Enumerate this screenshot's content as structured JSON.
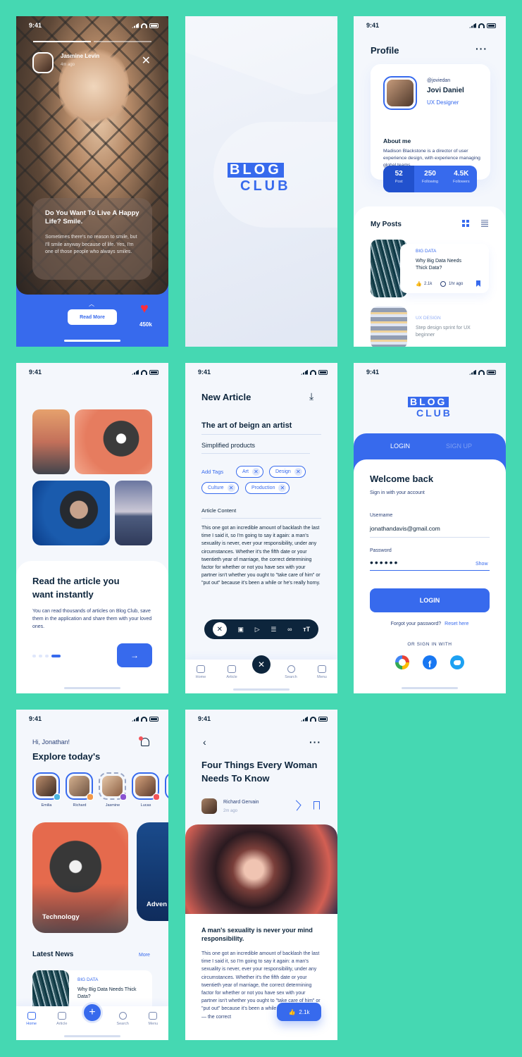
{
  "status_time": "9:41",
  "story": {
    "author": "Jasmine Levin",
    "time_ago": "4m ago",
    "title": "Do You Want To Live A Happy Life? Smile.",
    "body": "Sometimes there's no reason to smile, but I'll smile anyway because of life. Yes, I'm one of those people who always smiles.",
    "read_more": "Read More",
    "likes": "450k"
  },
  "splash": {
    "logo_line1": "BLOG",
    "logo_line2": "CLUB"
  },
  "profile": {
    "title": "Profile",
    "handle": "@joviedan",
    "name": "Jovi Daniel",
    "role": "UX Designer",
    "about_label": "About me",
    "about": "Madison Blackstone is a director of user experience design, with experience managing global teams.",
    "stats": [
      {
        "value": "52",
        "label": "Post"
      },
      {
        "value": "250",
        "label": "Following"
      },
      {
        "value": "4.5K",
        "label": "Followers"
      }
    ],
    "my_posts": "My Posts",
    "posts": [
      {
        "tag": "BIG DATA",
        "title": "Why Big Data Needs Thick Data?",
        "likes": "2.1k",
        "time": "1hr ago"
      },
      {
        "tag": "UX DESIGN",
        "title": "Step design sprint for UX beginner"
      }
    ]
  },
  "onboarding": {
    "title": "Read the article you want instantly",
    "body": "You can read thousands of articles on Blog Club, save them in the application and share them with your loved ones.",
    "next_icon": "arrow-right-icon"
  },
  "new_article": {
    "title": "New Article",
    "article_title": "The art of beign an artist",
    "subtitle": "Simplified products",
    "add_tags": "Add Tags",
    "tags": [
      "Art",
      "Design",
      "Culture",
      "Production"
    ],
    "content_label": "Article Content",
    "content": "This one got an incredible amount of backlash the last time I said it, so I'm going to say it again: a man's sexuality is never, ever your responsibility, under any circumstances. Whether it's the fifth date or your twentieth year of marriage, the correct determining factor for whether or not you have sex with your partner isn't whether you ought to \"take care of him\" or \"put out\" because it's been a while or he's really horny.",
    "nav": [
      "Home",
      "Article",
      "Search",
      "Menu"
    ]
  },
  "login": {
    "logo_line1": "BLOG",
    "logo_line2": "CLUB",
    "tab_login": "LOGIN",
    "tab_signup": "SIGN UP",
    "welcome": "Welcome back",
    "sub": "Sign in with your account",
    "username_label": "Username",
    "username_value": "jonathandavis@gmail.com",
    "password_label": "Password",
    "password_value": "••••••",
    "show": "Show",
    "button": "LOGIN",
    "forgot": "Forgot your password?",
    "reset": "Reset here",
    "or_sign": "OR SIGN IN WITH"
  },
  "home": {
    "greeting": "Hi, Jonathan!",
    "headline": "Explore today's",
    "stories": [
      "Emilia",
      "Richard",
      "Jasmine",
      "Lucas",
      "H"
    ],
    "cards": [
      "Technology",
      "Adven"
    ],
    "latest": "Latest News",
    "more": "More",
    "news": {
      "tag": "BIG DATA",
      "title": "Why Big Data Needs Thick Data?"
    },
    "nav": [
      "Home",
      "Article",
      "Search",
      "Menu"
    ]
  },
  "article": {
    "title": "Four Things Every Woman Needs To Know",
    "author": "Richard Gervain",
    "time_ago": "2m ago",
    "subtitle": "A man's sexuality is never your mind responsibility.",
    "body": "This one got an incredible amount of backlash the last time I said it, so I'm going to say it again: a man's sexuality is never, ever your responsibility, under any circumstances. Whether it's the fifth date or your twentieth year of marriage, the correct determining factor for whether or not you have sex with your partner isn't whether you ought to \"take care of him\" or \"put out\" because it's been a while or he's really horny — the correct",
    "likes": "2.1k"
  },
  "colors": {
    "accent": "#376aed",
    "bg": "#45d8b2",
    "dark": "#0d253c"
  }
}
